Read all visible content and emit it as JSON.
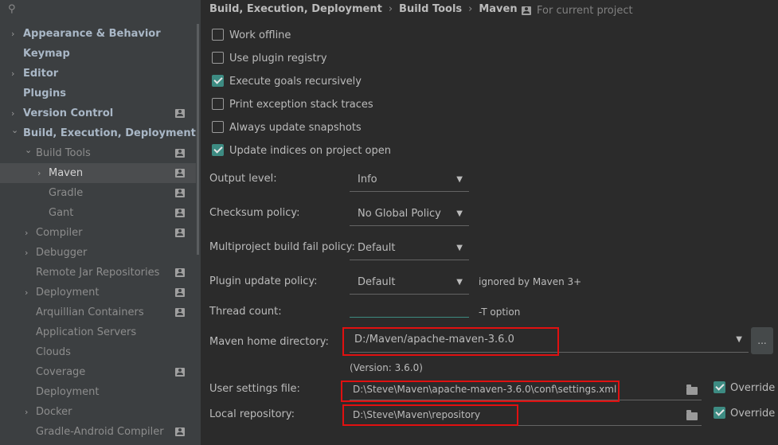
{
  "sidebar": {
    "search_icon": "search-icon",
    "items": [
      {
        "label": "Appearance & Behavior",
        "expand": "collapsed",
        "bold": true,
        "level": 0,
        "project": false,
        "selected": false
      },
      {
        "label": "Keymap",
        "expand": "none",
        "bold": true,
        "level": 0,
        "project": false,
        "selected": false
      },
      {
        "label": "Editor",
        "expand": "collapsed",
        "bold": true,
        "level": 0,
        "project": false,
        "selected": false
      },
      {
        "label": "Plugins",
        "expand": "none",
        "bold": true,
        "level": 0,
        "project": false,
        "selected": false
      },
      {
        "label": "Version Control",
        "expand": "collapsed",
        "bold": true,
        "level": 0,
        "project": true,
        "selected": false
      },
      {
        "label": "Build, Execution, Deployment",
        "expand": "expanded",
        "bold": true,
        "level": 0,
        "project": false,
        "selected": false
      },
      {
        "label": "Build Tools",
        "expand": "expanded",
        "bold": false,
        "level": 1,
        "project": true,
        "selected": false
      },
      {
        "label": "Maven",
        "expand": "collapsed",
        "bold": false,
        "level": 2,
        "project": true,
        "selected": true
      },
      {
        "label": "Gradle",
        "expand": "none",
        "bold": false,
        "level": 2,
        "project": true,
        "selected": false
      },
      {
        "label": "Gant",
        "expand": "none",
        "bold": false,
        "level": 2,
        "project": true,
        "selected": false
      },
      {
        "label": "Compiler",
        "expand": "collapsed",
        "bold": false,
        "level": 1,
        "project": true,
        "selected": false
      },
      {
        "label": "Debugger",
        "expand": "collapsed",
        "bold": false,
        "level": 1,
        "project": false,
        "selected": false
      },
      {
        "label": "Remote Jar Repositories",
        "expand": "none",
        "bold": false,
        "level": 1,
        "project": true,
        "selected": false
      },
      {
        "label": "Deployment",
        "expand": "collapsed",
        "bold": false,
        "level": 1,
        "project": true,
        "selected": false
      },
      {
        "label": "Arquillian Containers",
        "expand": "none",
        "bold": false,
        "level": 1,
        "project": true,
        "selected": false
      },
      {
        "label": "Application Servers",
        "expand": "none",
        "bold": false,
        "level": 1,
        "project": false,
        "selected": false
      },
      {
        "label": "Clouds",
        "expand": "none",
        "bold": false,
        "level": 1,
        "project": false,
        "selected": false
      },
      {
        "label": "Coverage",
        "expand": "none",
        "bold": false,
        "level": 1,
        "project": true,
        "selected": false
      },
      {
        "label": "Deployment",
        "expand": "none",
        "bold": false,
        "level": 1,
        "project": false,
        "selected": false
      },
      {
        "label": "Docker",
        "expand": "collapsed",
        "bold": false,
        "level": 1,
        "project": false,
        "selected": false
      },
      {
        "label": "Gradle-Android Compiler",
        "expand": "none",
        "bold": false,
        "level": 1,
        "project": true,
        "selected": false
      }
    ]
  },
  "header": {
    "breadcrumb": [
      "Build, Execution, Deployment",
      "Build Tools",
      "Maven"
    ],
    "breadcrumb_separator": "›",
    "scope_label": "For current project"
  },
  "options": [
    {
      "label": "Work offline",
      "checked": false
    },
    {
      "label": "Use plugin registry",
      "checked": false
    },
    {
      "label": "Execute goals recursively",
      "checked": true
    },
    {
      "label": "Print exception stack traces",
      "checked": false
    },
    {
      "label": "Always update snapshots",
      "checked": false
    },
    {
      "label": "Update indices on project open",
      "checked": true
    }
  ],
  "fields": {
    "output_level": {
      "label": "Output level:",
      "value": "Info"
    },
    "checksum_policy": {
      "label": "Checksum policy:",
      "value": "No Global Policy"
    },
    "multiproject_policy": {
      "label": "Multiproject build fail policy:",
      "value": "Default"
    },
    "plugin_update_policy": {
      "label": "Plugin update policy:",
      "value": "Default",
      "hint": "ignored by Maven 3+"
    },
    "thread_count": {
      "label": "Thread count:",
      "value": "",
      "hint": "-T option"
    },
    "maven_home": {
      "label": "Maven home directory:",
      "value": "D:/Maven/apache-maven-3.6.0",
      "browse_label": "...",
      "version": "(Version: 3.6.0)"
    },
    "user_settings": {
      "label": "User settings file:",
      "value": "D:\\Steve\\Maven\\apache-maven-3.6.0\\conf\\settings.xml",
      "override_label": "Override",
      "override_checked": true
    },
    "local_repo": {
      "label": "Local repository:",
      "value": "D:\\Steve\\Maven\\repository",
      "override_label": "Override",
      "override_checked": true
    }
  },
  "colors": {
    "sidebar_bg": "#3c3f41",
    "content_bg": "#2b2b2b",
    "checkbox_accent": "#3d8b82",
    "highlight_box": "#e01010"
  }
}
